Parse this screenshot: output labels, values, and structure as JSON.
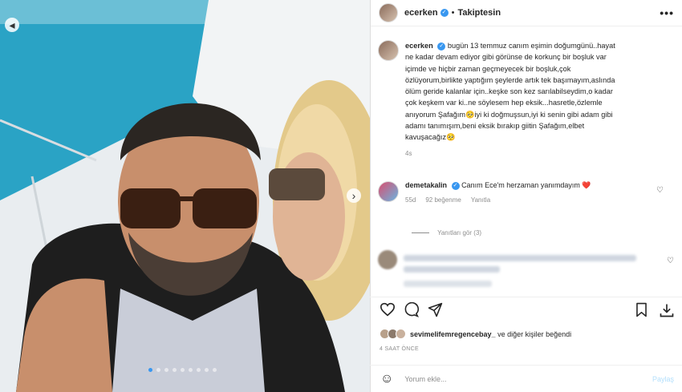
{
  "post": {
    "username": "ecerken",
    "separator": "•",
    "follow_label": "Takiptesin",
    "more_label": "•••",
    "caption_lines": [
      "bugün 13 temmuz canım eşimin doğumgünü..hayat",
      "ne kadar devam ediyor gibi görünse de korkunç bir boşluk var",
      "içimde ve hiçbir zaman geçmeyecek bir boşluk,çok",
      "özlüyorum,birlikte yaptığım şeylerde artık tek başımayım,aslında",
      "ölüm geride kalanlar için..keşke son kez sarılabilseydim,o kadar",
      "çok keşkem var ki..ne söylesem hep eksik...hasretle,özlemle",
      "anıyorum Şafağım🥺iyi ki doğmuşsun,iyi ki senin gibi adam gibi",
      "adamı tanımışım,beni eksik bırakıp giitin Şafağım,elbet",
      "kavuşacağız🥺"
    ],
    "caption_time": "4s"
  },
  "comment": {
    "username": "demetakalin",
    "text": "Canım Ece'm herzaman yanımdayım",
    "heart_emoji": "❤️",
    "time": "55d",
    "likes": "92 beğenme",
    "reply": "Yanıtla",
    "view_replies": "Yanıtları gör (3)"
  },
  "actions": {
    "like_icon": "heart-icon",
    "comment_icon": "comment-icon",
    "share_icon": "send-icon",
    "save_icon": "bookmark-icon",
    "download_icon": "download-icon"
  },
  "likes": {
    "user": "sevimelifemregencebay_",
    "rest": " ve diğer kişiler beğendi"
  },
  "post_time": "4 SAAT ÖNCE",
  "add_comment": {
    "placeholder": "Yorum ekle...",
    "post_label": "Paylaş"
  },
  "colors": {
    "verified": "#3897f0",
    "accent": "#3897f0",
    "heart": "#c0392b"
  }
}
